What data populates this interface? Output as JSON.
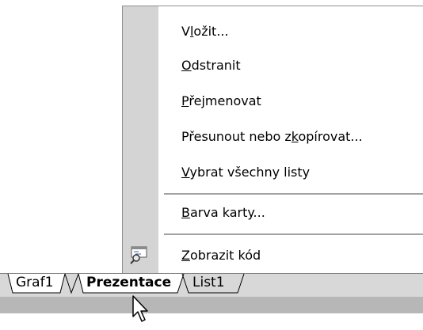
{
  "context_menu": {
    "items": [
      {
        "label": "Vložit...",
        "pre": "V",
        "key": "l",
        "post": "ožit..."
      },
      {
        "label": "Odstranit",
        "pre": "",
        "key": "O",
        "post": "dstranit"
      },
      {
        "label": "Přejmenovat",
        "pre": "",
        "key": "P",
        "post": "řejmenovat"
      },
      {
        "label": "Přesunout nebo zkopírovat...",
        "pre": "Přesunout nebo z",
        "key": "k",
        "post": "opírovat..."
      },
      {
        "label": "Vybrat všechny listy",
        "pre": "",
        "key": "V",
        "post": "ybrat všechny listy"
      },
      {
        "label": "Barva karty...",
        "pre": "",
        "key": "B",
        "post": "arva karty..."
      },
      {
        "label": "Zobrazit kód",
        "pre": "",
        "key": "Z",
        "post": "obrazit kód",
        "icon": "view-code-icon"
      }
    ]
  },
  "sheet_tabs": {
    "tabs": [
      {
        "label": "Graf1",
        "active": false
      },
      {
        "label": "Prezentace",
        "active": true
      },
      {
        "label": "List1",
        "active": false
      }
    ]
  },
  "colors": {
    "menu_gutter": "#d4d4d4",
    "tab_strip": "#d8d8d8",
    "status_bar": "#b7b7b7"
  }
}
